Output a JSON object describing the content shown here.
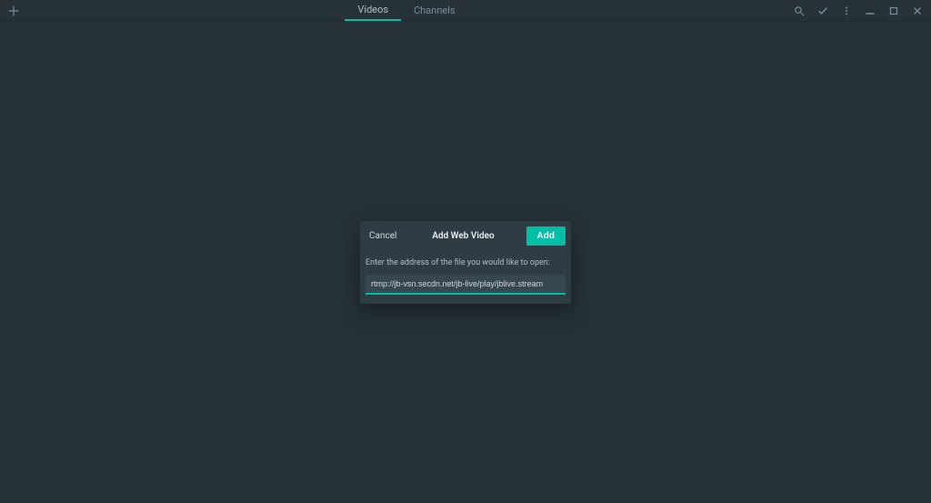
{
  "topbar": {
    "tabs": [
      {
        "label": "Videos",
        "active": true
      },
      {
        "label": "Channels",
        "active": false
      }
    ]
  },
  "dialog": {
    "cancel_label": "Cancel",
    "title": "Add Web Video",
    "add_label": "Add",
    "prompt": "Enter the address of the file you would like to open:",
    "input_value": "rtmp://jb-vsn.secdn.net/jb-live/play/jblive.stream"
  }
}
